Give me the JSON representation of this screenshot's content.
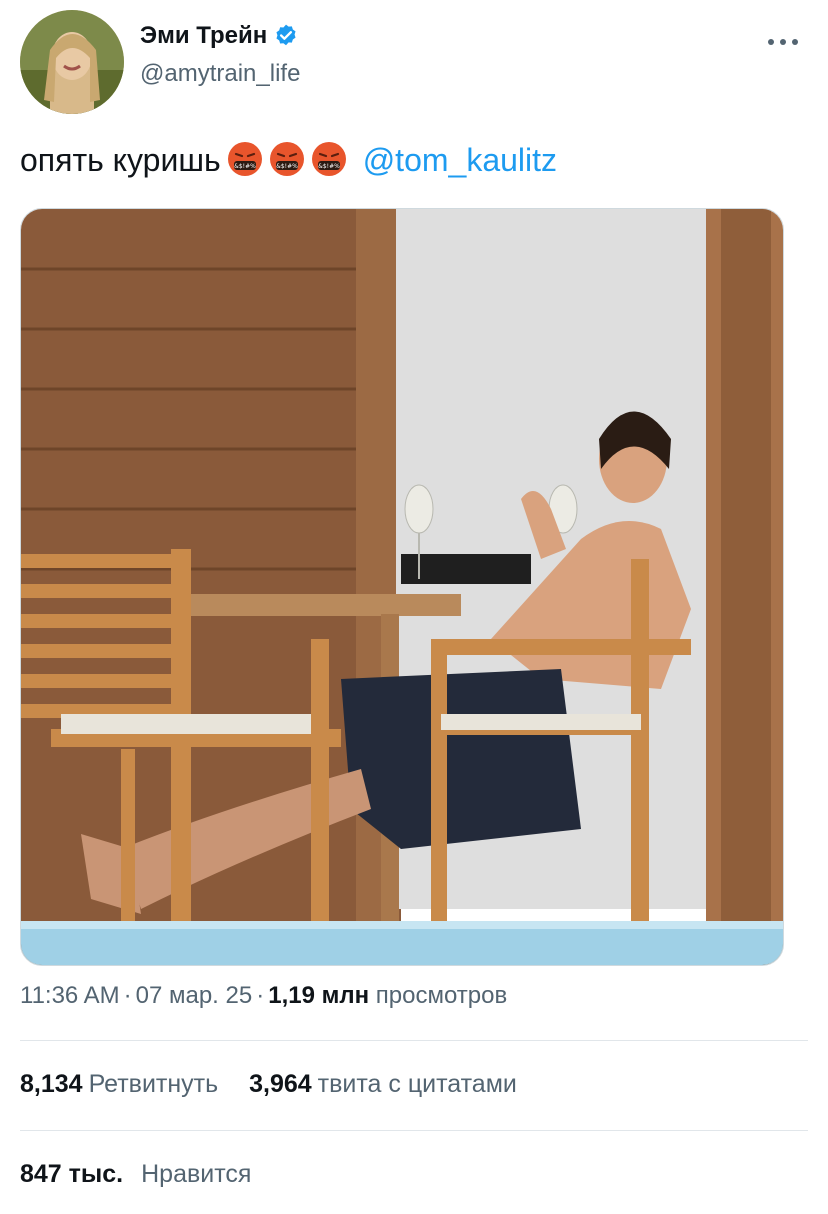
{
  "tweet": {
    "author": {
      "display_name": "Эми Трейн",
      "handle": "@amytrain_life",
      "verified": true,
      "avatar": "woman-portrait-avatar"
    },
    "more_icon": "ellipsis-icon",
    "text": "опять куришь",
    "emojis": [
      "face-with-symbols-on-mouth",
      "face-with-symbols-on-mouth",
      "face-with-symbols-on-mouth"
    ],
    "mention": "@tom_kaulitz",
    "media": "photo-man-smoking-on-balcony",
    "time": "11:36 AM",
    "date": "07 мар. 25",
    "views_count": "1,19 млн",
    "views_label": "просмотров",
    "retweets_count": "8,134",
    "retweets_label": "Ретвитнуть",
    "quotes_count": "3,964",
    "quotes_label": "твита с цитатами",
    "likes_count": "847 тыс.",
    "likes_label": "Нравится",
    "colors": {
      "link": "#1d9bf0",
      "secondary_text": "#536471",
      "verified": "#1d9bf0"
    }
  }
}
